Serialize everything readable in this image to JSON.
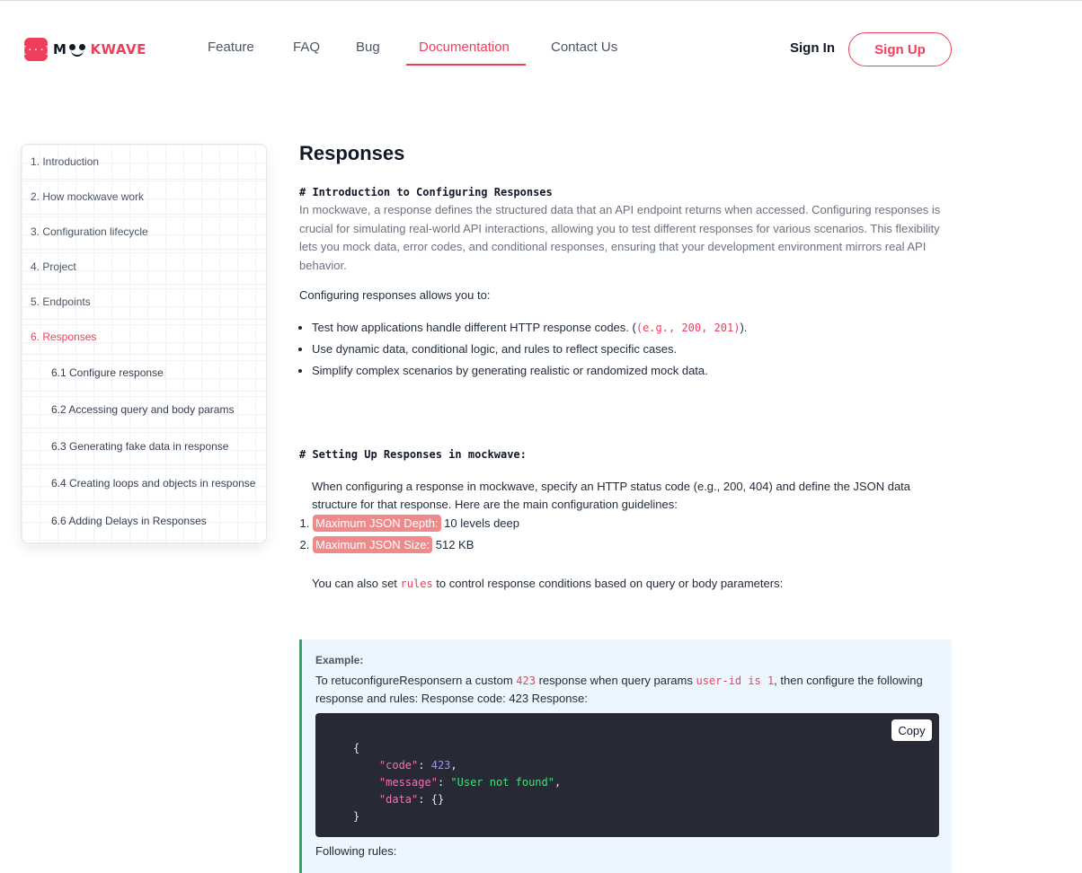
{
  "header": {
    "logo": {
      "mark": "{···}",
      "word_prefix": "M",
      "word_suffix": "KWAVE"
    },
    "nav": [
      {
        "label": "Feature"
      },
      {
        "label": "FAQ"
      },
      {
        "label": "Bug"
      },
      {
        "label": "Documentation",
        "active": true
      },
      {
        "label": "Contact Us"
      }
    ],
    "sign_in": "Sign In",
    "sign_up": "Sign Up"
  },
  "sidebar": {
    "items": [
      {
        "label": "1. Introduction"
      },
      {
        "label": "2. How mockwave work"
      },
      {
        "label": "3. Configuration lifecycle"
      },
      {
        "label": "4. Project"
      },
      {
        "label": "5. Endpoints"
      },
      {
        "label": "6. Responses",
        "active": true
      },
      {
        "label": "6.1 Configure response"
      },
      {
        "label": "6.2 Accessing query and body params"
      },
      {
        "label": "6.3 Generating fake data in response"
      },
      {
        "label": "6.4 Creating loops and objects in response"
      },
      {
        "label": "6.6 Adding Delays in Responses"
      }
    ]
  },
  "content": {
    "title": "Responses",
    "intro_heading": "# Introduction to Configuring Responses",
    "intro_text": "In mockwave, a response defines the structured data that an API endpoint returns when accessed. Configuring responses is crucial for simulating real-world API interactions, allowing you to test different responses for various scenarios. This flexibility lets you mock data, error codes, and conditional responses, ensuring that your development environment mirrors real API behavior.",
    "allows_text": "Configuring responses allows you to:",
    "bullets": {
      "b1_text": "Test how applications handle different HTTP response codes. (",
      "b1_code": "(e.g., 200, 201)",
      "b1_end": ").",
      "b2": "Use dynamic data, conditional logic, and rules to reflect specific cases.",
      "b3": "Simplify complex scenarios by generating realistic or randomized mock data."
    },
    "setup_heading": "# Setting Up Responses in mockwave:",
    "setup_text": "When configuring a response in mockwave, specify an HTTP status code (e.g., 200, 404) and define the JSON data structure for that response. Here are the main configuration guidelines:",
    "limits": [
      {
        "label": "Maximum JSON Depth:",
        "value": " 10 levels deep"
      },
      {
        "label": "Maximum JSON Size:",
        "value": " 512 KB"
      }
    ],
    "rules_pre": "You can also set ",
    "rules_code": "rules",
    "rules_post": " to control response conditions based on query or body parameters:",
    "example": {
      "label": "Example:",
      "t1": "To retuconfigureResponsern a custom ",
      "c1": "423",
      "t2": " response when query params ",
      "c2": "user-id is 1",
      "t3": ", then configure the following response and rules: Response code: 423 Response:",
      "copy": "Copy",
      "code": {
        "open": "{",
        "k1": "\"code\"",
        "v1": "423",
        "k2": "\"message\"",
        "v2": "\"User not found\"",
        "k3": "\"data\"",
        "v3": "{}",
        "close": "}"
      },
      "following": "Following rules:"
    }
  }
}
